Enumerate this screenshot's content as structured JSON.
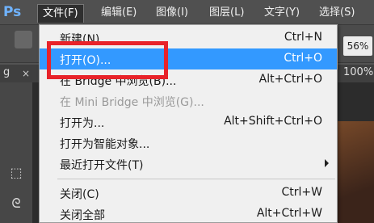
{
  "app": {
    "logo": "Ps"
  },
  "menubar": {
    "items": [
      {
        "label": "文件(F)"
      },
      {
        "label": "编辑(E)"
      },
      {
        "label": "图像(I)"
      },
      {
        "label": "图层(L)"
      },
      {
        "label": "文字(Y)"
      },
      {
        "label": "选择(S)"
      }
    ]
  },
  "optionsbar": {
    "zoom_right": "56%"
  },
  "document": {
    "tab_left": "g",
    "tab_close": "×",
    "tab_right": "100%"
  },
  "toolbar": {
    "tools": [
      {
        "name": "marquee-tool",
        "glyph": "⬚"
      },
      {
        "name": "lasso-tool",
        "glyph": "ᘓ"
      }
    ]
  },
  "file_menu": {
    "items": [
      {
        "label": "新建(N)...",
        "shortcut": "Ctrl+N",
        "state": "normal"
      },
      {
        "label": "打开(O)...",
        "shortcut": "Ctrl+O",
        "state": "highlighted"
      },
      {
        "label": "在 Bridge 中浏览(B)...",
        "shortcut": "Alt+Ctrl+O",
        "state": "normal"
      },
      {
        "label": "在 Mini Bridge 中浏览(G)...",
        "shortcut": "",
        "state": "disabled"
      },
      {
        "label": "打开为...",
        "shortcut": "Alt+Shift+Ctrl+O",
        "state": "normal"
      },
      {
        "label": "打开为智能对象...",
        "shortcut": "",
        "state": "normal"
      },
      {
        "label": "最近打开文件(T)",
        "shortcut": "",
        "state": "normal",
        "submenu": true
      },
      {
        "label": "关闭(C)",
        "shortcut": "Ctrl+W",
        "state": "normal"
      },
      {
        "label": "关闭全部",
        "shortcut": "Alt+Ctrl+W",
        "state": "normal"
      }
    ]
  },
  "colors": {
    "highlight": "#3399ff",
    "annotation": "#e8232a",
    "menu_bg": "#f0f0f0",
    "app_bg": "#535353"
  }
}
